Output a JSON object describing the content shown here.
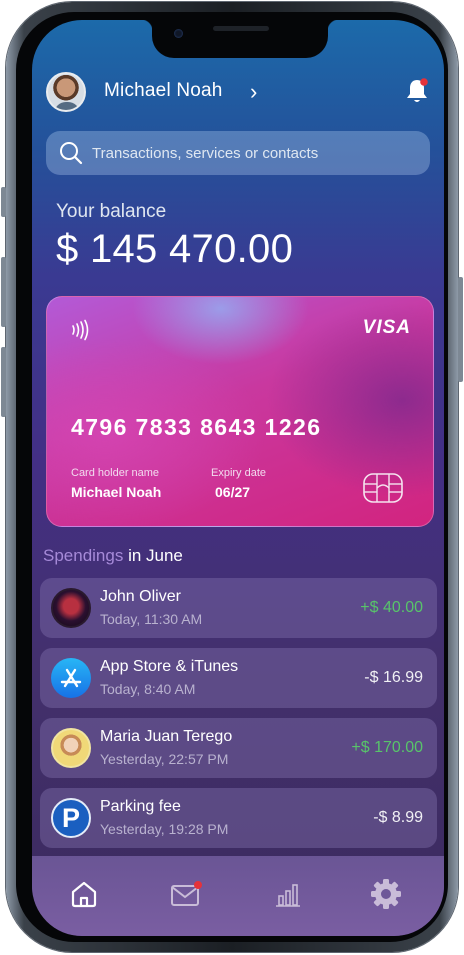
{
  "user": {
    "name": "Michael Noah",
    "chevron": "›"
  },
  "search": {
    "placeholder": "Transactions, services or contacts"
  },
  "balance": {
    "label": "Your balance",
    "value": "$ 145 470.00"
  },
  "card": {
    "brand": "VISA",
    "number": "4796 7833 8643 1226",
    "holder_label": "Card holder name",
    "holder": "Michael Noah",
    "expiry_label": "Expiry date",
    "expiry": "06/27"
  },
  "spendings": {
    "title_highlight": "Spendings",
    "title_rest": " in June"
  },
  "transactions": [
    {
      "name": "John Oliver",
      "time": "Today, 11:30 AM",
      "amount": "+$ 40.00",
      "type": "income",
      "icon": "avatar-john"
    },
    {
      "name": "App Store & iTunes",
      "time": "Today, 8:40 AM",
      "amount": "-$ 16.99",
      "type": "expense",
      "icon": "appstore-icon"
    },
    {
      "name": "Maria Juan Terego",
      "time": "Yesterday, 22:57 PM",
      "amount": "+$ 170.00",
      "type": "income",
      "icon": "avatar-maria"
    },
    {
      "name": "Parking fee",
      "time": "Yesterday, 19:28 PM",
      "amount": "-$ 8.99",
      "type": "expense",
      "icon": "parking-icon",
      "icon_letter": "P"
    }
  ],
  "tabbar": {
    "items": [
      "home-icon",
      "mail-icon",
      "stats-icon",
      "settings-icon"
    ],
    "active": "home-icon"
  },
  "colors": {
    "income": "#58c46a",
    "expense": "#f1f1f5",
    "badge": "#e5323a",
    "accent": "#a68ad8"
  }
}
